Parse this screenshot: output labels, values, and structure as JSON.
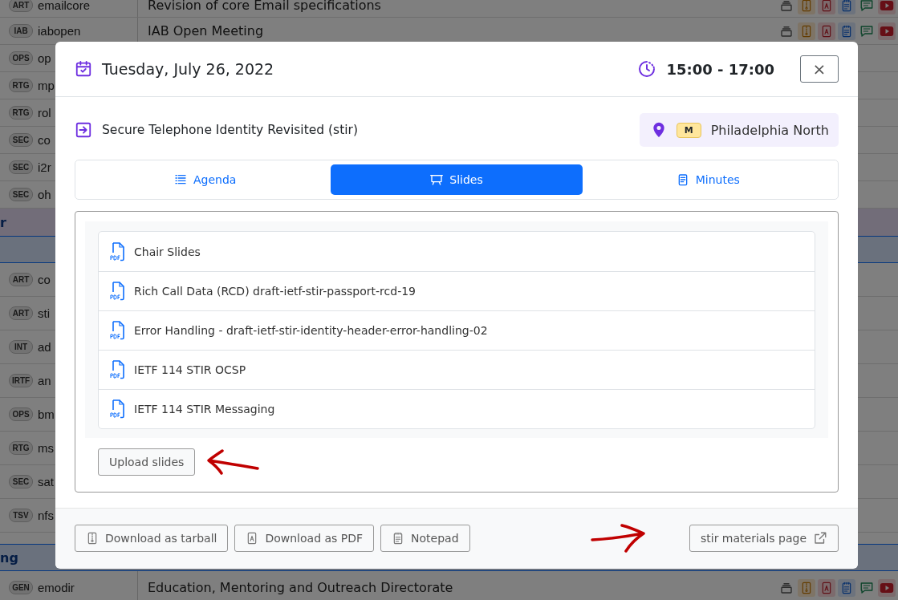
{
  "background": {
    "sections": [
      {
        "kind": "rows",
        "rows": [
          {
            "area": "ART",
            "acronym": "emailcore",
            "title": "Revision of core Email specifications"
          },
          {
            "area": "IAB",
            "acronym": "iabopen",
            "title": "IAB Open Meeting"
          },
          {
            "area": "OPS",
            "acronym": "op"
          },
          {
            "area": "RTG",
            "acronym": "mp"
          },
          {
            "area": "RTG",
            "acronym": "rol"
          },
          {
            "area": "SEC",
            "acronym": "co"
          },
          {
            "area": "SEC",
            "acronym": "i2r"
          },
          {
            "area": "SEC",
            "acronym": "oh"
          }
        ]
      },
      {
        "kind": "header",
        "label": "r",
        "color": "#e4daf2"
      },
      {
        "kind": "header"
      },
      {
        "kind": "rows",
        "rows": [
          {
            "area": "ART",
            "acronym": "co"
          },
          {
            "area": "ART",
            "acronym": "sti"
          },
          {
            "area": "INT",
            "acronym": "ad"
          },
          {
            "area": "IRTF",
            "acronym": "an"
          },
          {
            "area": "OPS",
            "acronym": "bm"
          },
          {
            "area": "RTG",
            "acronym": "ms"
          },
          {
            "area": "SEC",
            "acronym": "sat"
          },
          {
            "area": "TSV",
            "acronym": "nfs"
          }
        ]
      },
      {
        "kind": "header",
        "label": "ng"
      },
      {
        "kind": "rows",
        "rows": [
          {
            "area": "GEN",
            "acronym": "emodir",
            "title": "Education, Mentoring and Outreach Directorate"
          }
        ]
      }
    ]
  },
  "modal": {
    "date": "Tuesday, July 26, 2022",
    "time": "15:00 - 17:00",
    "close": "×",
    "session": "Secure Telephone Identity Revisited (stir)",
    "location": {
      "floor": "M",
      "room": "Philadelphia North"
    },
    "tabs": [
      {
        "label": "Agenda",
        "selected": false
      },
      {
        "label": "Slides",
        "selected": true
      },
      {
        "label": "Minutes",
        "selected": false
      }
    ],
    "slides": [
      "Chair Slides",
      "Rich Call Data (RCD) draft-ietf-stir-passport-rcd-19",
      "Error Handling - draft-ietf-stir-identity-header-error-handling-02",
      "IETF 114 STIR OCSP",
      "IETF 114 STIR Messaging"
    ],
    "upload": "Upload slides",
    "footer_buttons": [
      "Download as tarball",
      "Download as PDF",
      "Notepad"
    ],
    "materials_link": "stir materials page"
  }
}
